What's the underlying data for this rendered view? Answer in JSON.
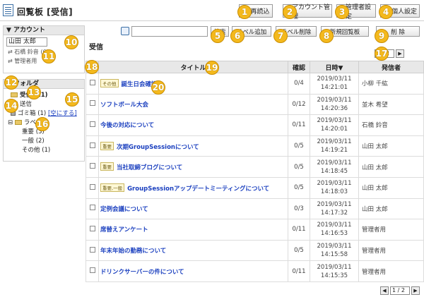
{
  "app": {
    "title": "回覧板 [受信]"
  },
  "top_buttons": [
    {
      "label": "再読込",
      "num": "1"
    },
    {
      "label": "アカウント管理",
      "num": "2"
    },
    {
      "label": "管理者設定",
      "num": "3"
    },
    {
      "label": "個人設定",
      "num": "4"
    }
  ],
  "toolbar": {
    "search_label": "検索",
    "label_add": "ラベル追加",
    "label_delete": "ラベル削除",
    "new_post": "新規回覧板",
    "delete": "削 除",
    "nums": {
      "search": "5",
      "label_add": "6",
      "label_delete": "7",
      "new_post": "8",
      "delete": "9"
    }
  },
  "account": {
    "header": "▼ アカウント",
    "selected": "山田 太郎",
    "items": [
      "石橋 鈴音 (6)",
      "管理者用"
    ],
    "num_select": "10",
    "num_items": "11"
  },
  "folder": {
    "header": "▼ フォルダ",
    "inbox": "受信 (11)",
    "sent": "送信",
    "trash": "ゴミ箱 (1)",
    "empty_trash": "[空にする]",
    "label_root": "ラベル",
    "labels": [
      "重要 (3)",
      "一般 (2)",
      "その他 (1)"
    ],
    "nums": {
      "inbox": "12",
      "sent": "13",
      "trash": "14",
      "empty": "15",
      "labels": "16"
    }
  },
  "main": {
    "heading": "受信"
  },
  "pager": {
    "page": "1 / 2",
    "num": "17"
  },
  "table": {
    "headers": {
      "title": "タイトル",
      "confirm": "確認",
      "date": "日時▼",
      "sender": "発信者"
    },
    "nums": {
      "checkbox": "18",
      "title": "19",
      "row_title": "20"
    },
    "rows": [
      {
        "label": "その他",
        "title": "誕生日会確認",
        "confirm": "0/4",
        "date": "2019/03/11",
        "time": "14:21:01",
        "sender": "小柳 千紘"
      },
      {
        "label": "",
        "title": "ソフトボール大会",
        "confirm": "0/12",
        "date": "2019/03/11",
        "time": "14:20:36",
        "sender": "並木 希望"
      },
      {
        "label": "",
        "title": "今後の対応について",
        "confirm": "0/11",
        "date": "2019/03/11",
        "time": "14:20:01",
        "sender": "石橋 鈴音"
      },
      {
        "label": "重要",
        "title": "次期GroupSessionについて",
        "confirm": "0/5",
        "date": "2019/03/11",
        "time": "14:19:21",
        "sender": "山田 太郎"
      },
      {
        "label": "重要",
        "title": "当社取締ブログについて",
        "confirm": "0/5",
        "date": "2019/03/11",
        "time": "14:18:45",
        "sender": "山田 太郎"
      },
      {
        "label": "重要,一般",
        "title": "GroupSessionアップデートミーティングについて",
        "confirm": "0/5",
        "date": "2019/03/11",
        "time": "14:18:03",
        "sender": "山田 太郎"
      },
      {
        "label": "",
        "title": "定例会議について",
        "confirm": "0/3",
        "date": "2019/03/11",
        "time": "14:17:32",
        "sender": "山田 太郎"
      },
      {
        "label": "",
        "title": "席替えアンケート",
        "confirm": "0/11",
        "date": "2019/03/11",
        "time": "14:16:53",
        "sender": "管理者用"
      },
      {
        "label": "",
        "title": "年末年始の勤務について",
        "confirm": "0/5",
        "date": "2019/03/11",
        "time": "14:15:58",
        "sender": "管理者用"
      },
      {
        "label": "",
        "title": "ドリンクサーバーの件について",
        "confirm": "0/11",
        "date": "2019/03/11",
        "time": "14:15:35",
        "sender": "管理者用"
      }
    ]
  }
}
